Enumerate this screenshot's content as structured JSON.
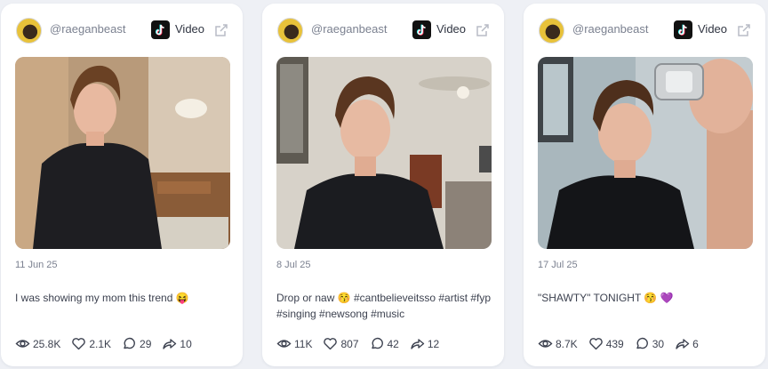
{
  "posts": [
    {
      "handle": "@raeganbeast",
      "platform": "Video",
      "date": "11 Jun 25",
      "caption": "I was showing my mom this trend 😝",
      "stats": {
        "views": "25.8K",
        "likes": "2.1K",
        "comments": "29",
        "shares": "10"
      }
    },
    {
      "handle": "@raeganbeast",
      "platform": "Video",
      "date": "8 Jul 25",
      "caption": "Drop or naw 😚 #cantbelieveitsso #artist #fyp #singing #newsong #music",
      "stats": {
        "views": "11K",
        "likes": "807",
        "comments": "42",
        "shares": "12"
      }
    },
    {
      "handle": "@raeganbeast",
      "platform": "Video",
      "date": "17 Jul 25",
      "caption": "\"SHAWTY\" TONIGHT 😚 💜",
      "stats": {
        "views": "8.7K",
        "likes": "439",
        "comments": "30",
        "shares": "6"
      }
    }
  ],
  "icons": {
    "platform": "tiktok-icon",
    "external": "external-link-icon",
    "views": "eye-icon",
    "likes": "heart-icon",
    "comments": "comment-icon",
    "shares": "share-icon"
  }
}
